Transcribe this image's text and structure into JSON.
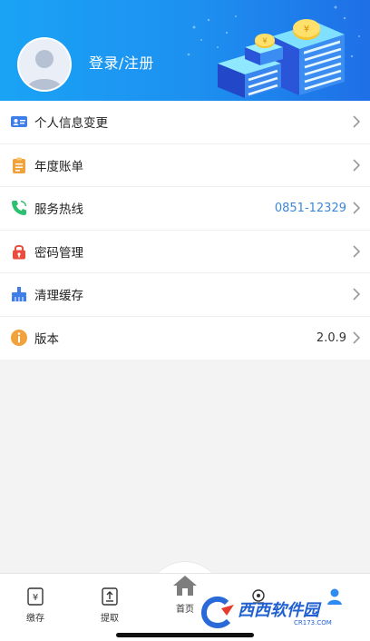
{
  "header": {
    "login_label": "登录/注册",
    "coin_symbol": "¥",
    "colors": {
      "gradient_start": "#1aa3f5",
      "gradient_end": "#1f6fe6"
    }
  },
  "menu": {
    "items": [
      {
        "icon": "id-card-icon",
        "label": "个人信息变更",
        "value": "",
        "icon_color": "#3f7ee8"
      },
      {
        "icon": "clipboard-icon",
        "label": "年度账单",
        "value": "",
        "icon_color": "#f2a23a"
      },
      {
        "icon": "phone-icon",
        "label": "服务热线",
        "value": "0851-12329",
        "icon_color": "#2fbf71",
        "value_color": "#3d86d8"
      },
      {
        "icon": "lock-icon",
        "label": "密码管理",
        "value": "",
        "icon_color": "#e94d3d"
      },
      {
        "icon": "broom-icon",
        "label": "清理缓存",
        "value": "",
        "icon_color": "#3f7ee8"
      },
      {
        "icon": "info-icon",
        "label": "版本",
        "value": "2.0.9",
        "icon_color": "#f2a23a",
        "value_color": "#333333"
      }
    ]
  },
  "tabbar": {
    "tabs": [
      {
        "icon": "deposit-icon",
        "label": "缴存"
      },
      {
        "icon": "withdraw-icon",
        "label": "提取"
      },
      {
        "icon": "home-icon",
        "label": "首页"
      },
      {
        "icon": "service-icon",
        "label": ""
      },
      {
        "icon": "profile-icon",
        "label": ""
      }
    ]
  },
  "watermark": {
    "text": "西西软件园",
    "sub": "CR173.COM"
  }
}
